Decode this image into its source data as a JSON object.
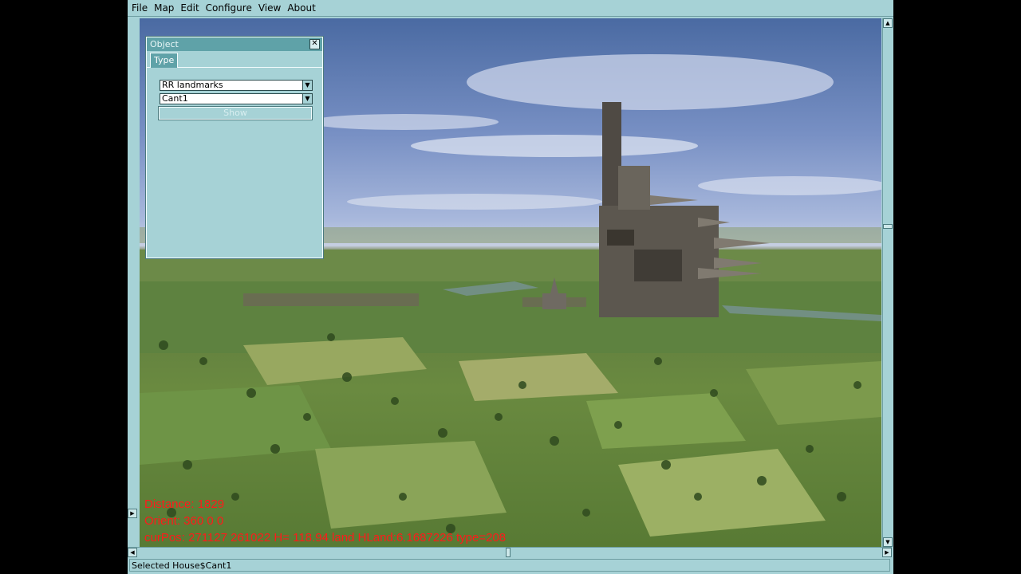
{
  "menubar": {
    "items": [
      "File",
      "Map",
      "Edit",
      "Configure",
      "View",
      "About"
    ]
  },
  "object_panel": {
    "title": "Object",
    "close_symbol": "✕",
    "tab_label": "Type",
    "category_select": "RR landmarks",
    "object_select": "Cant1",
    "show_label": "Show"
  },
  "hud": {
    "distance": "Distance: 1829",
    "orient": "Orient: 360 0 0",
    "curpos": "curPos: 271127 261022 H= 118.94 land HLand:6.1687226 type=208"
  },
  "status": {
    "text": "Selected House$Cant1"
  },
  "colors": {
    "chrome": "#a6d2d6",
    "panel_title": "#5fa2a8",
    "hud_text": "#ff1a1a"
  }
}
